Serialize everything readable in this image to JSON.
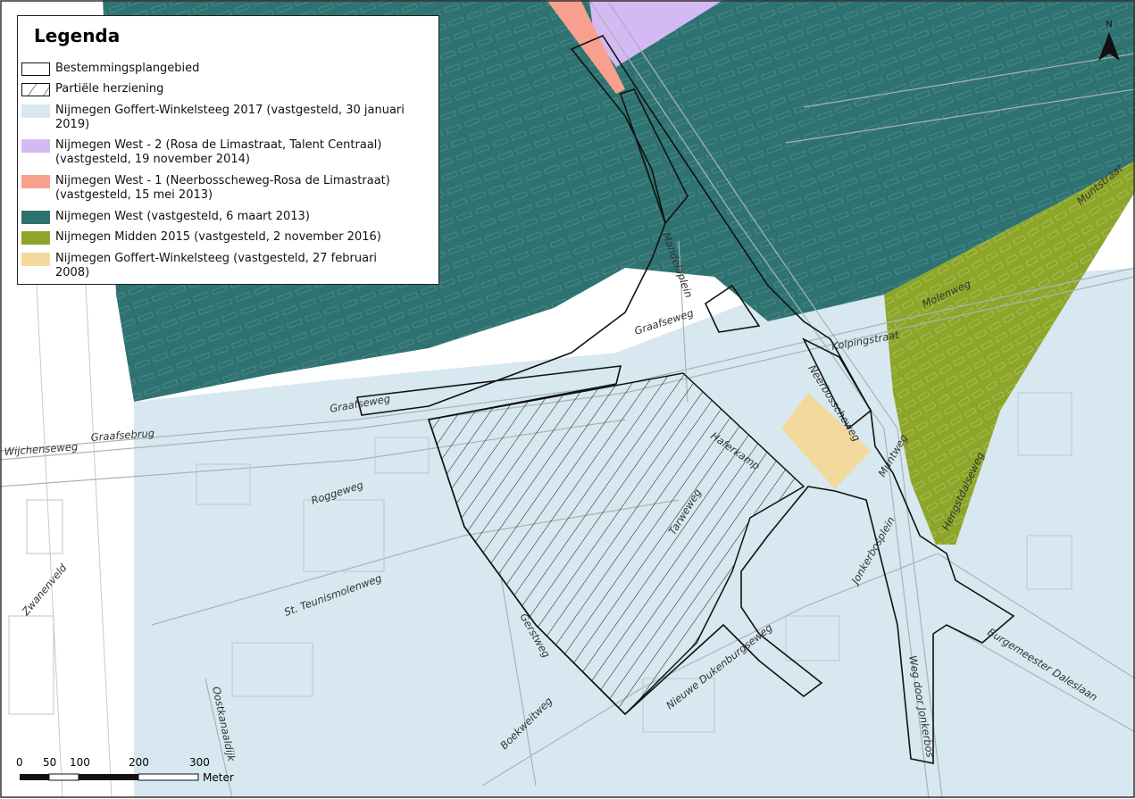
{
  "legend": {
    "title": "Legenda",
    "items": [
      {
        "label": "Bestemmingsplangebied",
        "style": "outline"
      },
      {
        "label": "Partiële herziening",
        "style": "hatch"
      },
      {
        "label": "Nijmegen Goffert-Winkelsteeg 2017 (vastgesteld, 30 januari\n2019)",
        "color": "#d8e8f0"
      },
      {
        "label": "Nijmegen West - 2 (Rosa de Limastraat, Talent Centraal)\n(vastgesteld, 19 november 2014)",
        "color": "#d5b9f2"
      },
      {
        "label": "Nijmegen West - 1 (Neerbosscheweg-Rosa de Limastraat)\n(vastgesteld, 15 mei 2013)",
        "color": "#f7a08e"
      },
      {
        "label": "Nijmegen West (vastgesteld, 6 maart 2013)",
        "color": "#2e7371"
      },
      {
        "label": "Nijmegen Midden 2015 (vastgesteld, 2 november 2016)",
        "color": "#8da62a"
      },
      {
        "label": "Nijmegen Goffert-Winkelsteeg (vastgesteld, 27 februari 2008)",
        "color": "#f3d99b"
      }
    ]
  },
  "north_arrow": {
    "label": "N"
  },
  "scale": {
    "ticks": [
      "0",
      "50",
      "100",
      "200",
      "300"
    ],
    "unit": "Meter"
  },
  "streets": [
    {
      "name": "Graafseweg"
    },
    {
      "name": "Graafsebrug"
    },
    {
      "name": "Wijchenseweg"
    },
    {
      "name": "Graafseweg"
    },
    {
      "name": "Mandelaplein"
    },
    {
      "name": "Roggeweg"
    },
    {
      "name": "St. Teunismolenweg"
    },
    {
      "name": "Zwanenveld"
    },
    {
      "name": "Oostkanaaldijk"
    },
    {
      "name": "Gerstweg"
    },
    {
      "name": "Boekweitweg"
    },
    {
      "name": "Nieuwe Dukenburgseweg"
    },
    {
      "name": "Tarweweg"
    },
    {
      "name": "Haferkamp"
    },
    {
      "name": "Kolpingstraat"
    },
    {
      "name": "Neerbosscheweg"
    },
    {
      "name": "Muntweg"
    },
    {
      "name": "Jonkerbosplein"
    },
    {
      "name": "Weg door Jonkerbos"
    },
    {
      "name": "Burgemeester Daleslaan"
    },
    {
      "name": "Hengstdalseweg"
    },
    {
      "name": "Muntstraat"
    },
    {
      "name": "Molenweg"
    }
  ],
  "colors": {
    "goffert2017": "#d8e8f0",
    "west2": "#d5b9f2",
    "west1": "#f7a08e",
    "west": "#2e7371",
    "midden2015": "#8da62a",
    "goffert2008": "#f3d99b"
  }
}
